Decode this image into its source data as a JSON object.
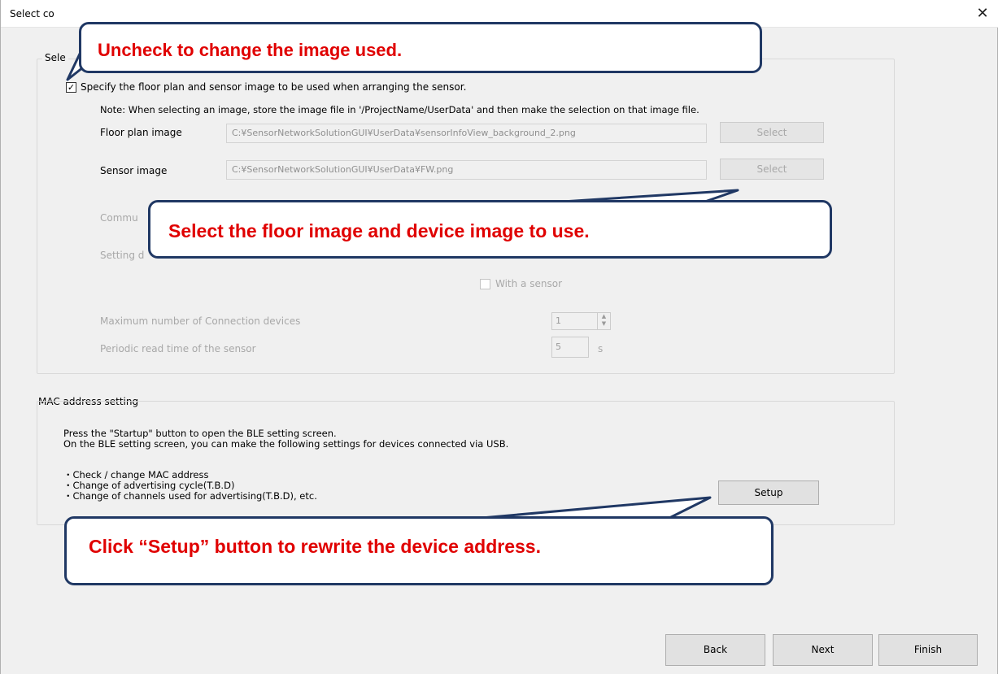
{
  "window": {
    "title": "Select co",
    "close_glyph": "✕"
  },
  "image_group": {
    "label": "Sele",
    "specify_checkbox_checked": true,
    "specify_checkbox_glyph": "✓",
    "specify_label": "Specify the floor plan and sensor image to be used when arranging the sensor.",
    "note": "Note: When selecting an image, store the image file in '/ProjectName/UserData' and then make the selection on that image file.",
    "floor_plan_label": "Floor plan image",
    "floor_plan_value": "C:¥SensorNetworkSolutionGUI¥UserData¥sensorInfoView_background_2.png",
    "floor_select_label": "Select",
    "sensor_image_label": "Sensor image",
    "sensor_image_value": "C:¥SensorNetworkSolutionGUI¥UserData¥FW.png",
    "sensor_select_label": "Select",
    "comm_label": "Commu",
    "setting_label": "Setting d",
    "with_sensor_label": "With a sensor",
    "max_conn_label": "Maximum number of Connection devices",
    "max_conn_value": "1",
    "spin_glyph": "▲▼",
    "periodic_label": "Periodic read time of the sensor",
    "periodic_value": "5",
    "periodic_unit": "s"
  },
  "mac_group": {
    "label": "MAC address setting",
    "description": "Press the \"Startup\" button to open the BLE setting screen.\nOn the BLE setting screen, you can make the following settings for devices connected via USB.",
    "bullets": "・Check / change MAC address\n・Change of advertising cycle(T.B.D)\n・Change of channels used for advertising(T.B.D), etc.",
    "setup_label": "Setup"
  },
  "footer": {
    "back_label": "Back",
    "next_label": "Next",
    "finish_label": "Finish"
  },
  "callouts": {
    "uncheck": "Uncheck to change the image used.",
    "select_images": "Select the floor image and device image to use.",
    "setup": "Click “Setup” button to rewrite the device address."
  },
  "colors": {
    "callout_text": "#e00000",
    "callout_border": "#203864",
    "window_bg": "#f0f0f0"
  }
}
